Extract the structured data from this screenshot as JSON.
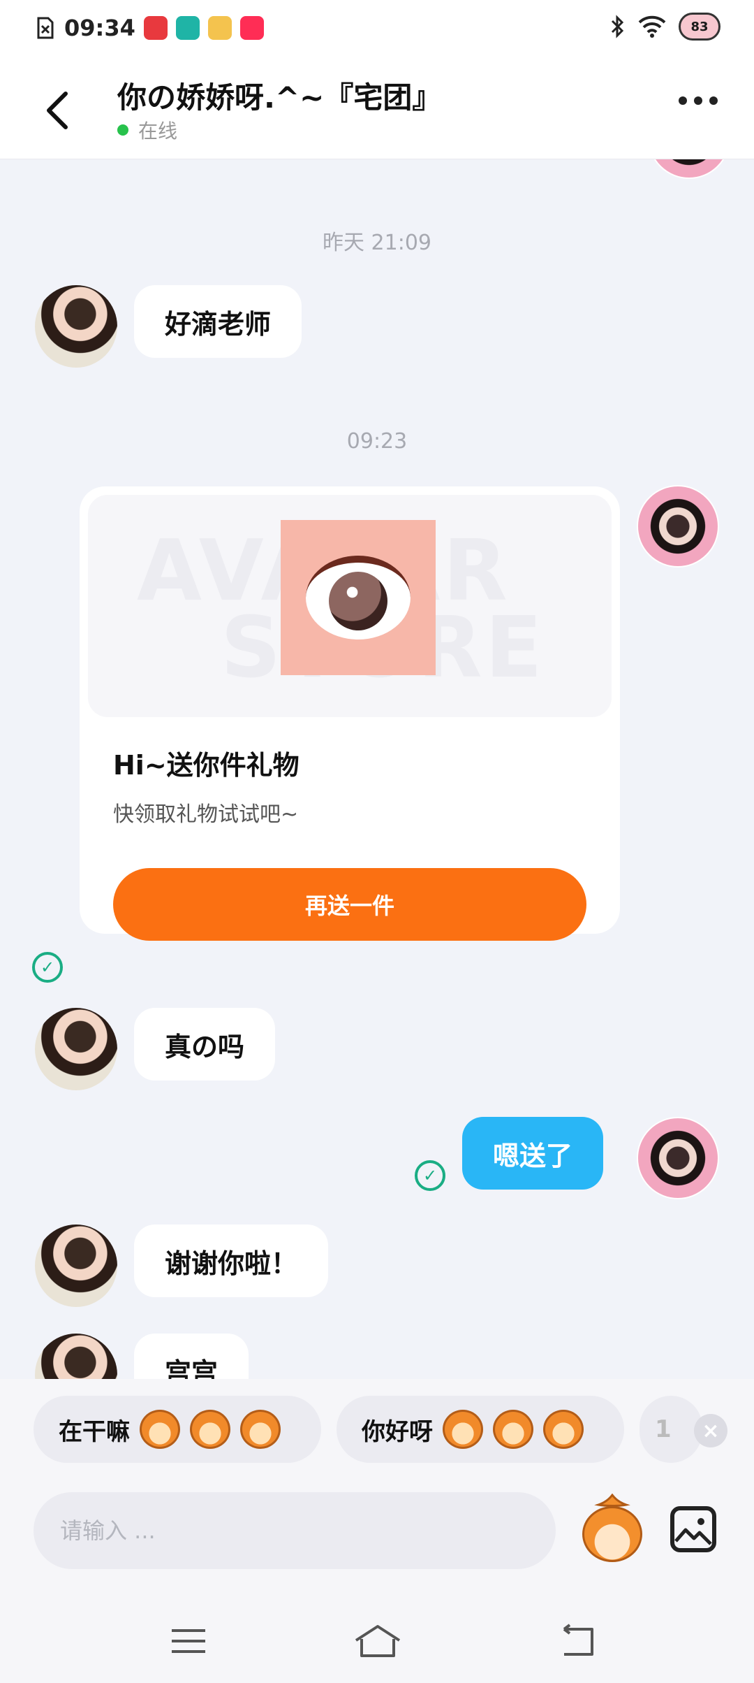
{
  "status_bar": {
    "time": "09:34",
    "battery": "83",
    "app_icon_colors": [
      "#e8393e",
      "#1fb4a6",
      "#f4c34e",
      "#ff2d55"
    ]
  },
  "header": {
    "title": "你の娇娇呀.^~『宅团』",
    "status": "在线",
    "online_color": "#27c24c"
  },
  "messages": {
    "timestamp_1": "昨天 21:09",
    "msg_1": "好滴老师",
    "timestamp_2": "09:23",
    "gift_card": {
      "watermark_line_1": "AVATAR",
      "watermark_line_2": "STORE",
      "title": "Hi~送你件礼物",
      "subtitle": "快领取礼物试试吧~",
      "button": "再送一件",
      "button_color": "#fb7012"
    },
    "msg_2": "真の吗",
    "msg_3": "嗯送了",
    "msg_3_color": "#29b6f6",
    "msg_4": "谢谢你啦！",
    "msg_5": "宫宫"
  },
  "quick_replies": {
    "items": [
      "在干嘛",
      "你好呀",
      "1"
    ]
  },
  "composer": {
    "placeholder": "请输入 ..."
  },
  "icons": {
    "back": "back-arrow-icon",
    "more": "more-dots-icon",
    "sent": "check-circle-icon",
    "image": "image-icon",
    "mascot": "mascot-sticker-icon",
    "close": "close-icon"
  }
}
